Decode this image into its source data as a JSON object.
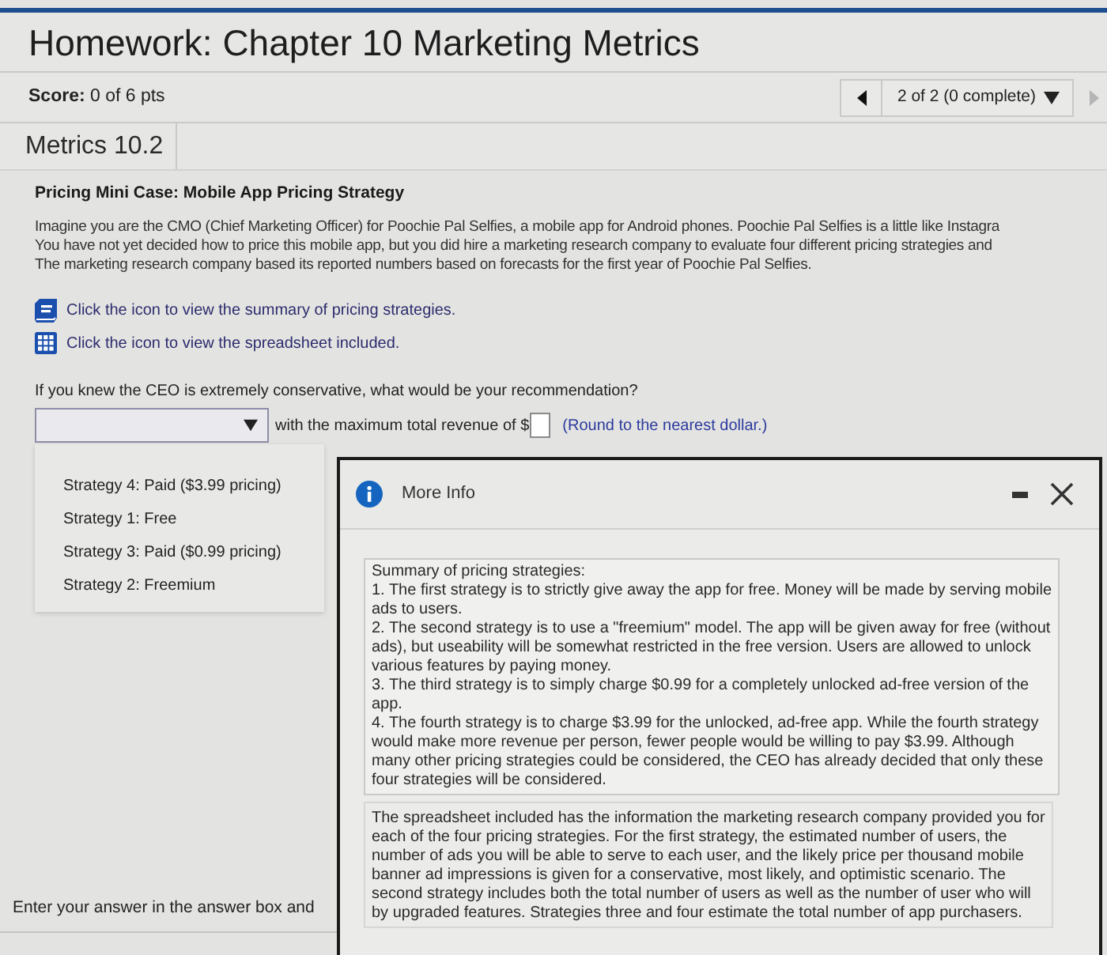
{
  "header": {
    "title": "Homework: Chapter 10 Marketing Metrics",
    "score": "**Score:** 0 of 6 pts",
    "navigator": {
      "label": "2 of 2 (0 complete)",
      "previous_disabled": false,
      "next_disabled": true
    }
  },
  "section": {
    "title": "Metrics 10.2"
  },
  "case": {
    "title": "Pricing Mini Case: Mobile App Pricing Strategy",
    "intro_lines": [
      "Imagine you are the CMO (Chief Marketing Officer) for Poochie Pal Selfies, a mobile app for Android phones. Poochie Pal Selfies is a little like Instagra",
      "You have not yet decided how to price this mobile app, but you did hire a marketing research company to evaluate four different pricing strategies and",
      "The marketing research company based its reported numbers based on forecasts for the first year of Poochie Pal Selfies."
    ],
    "links": [
      {
        "kind": "book",
        "text": "Click the icon to view the summary of pricing strategies."
      },
      {
        "kind": "table",
        "text": "Click the icon to view the spreadsheet included."
      }
    ]
  },
  "question": {
    "text": "If you knew the CEO is extremely conservative, what would be your recommendation?",
    "dropdown": {
      "expanded": true,
      "options": [
        {
          "label": "Strategy 4: Paid ($3.99 pricing)",
          "selected": false
        },
        {
          "label": "Strategy 1: Free",
          "selected": false
        },
        {
          "label": "Strategy 3: Paid ($0.99 pricing)",
          "selected": false
        },
        {
          "label": "Strategy 2: Freemium",
          "selected": false
        }
      ]
    },
    "revenue_label": "with the maximum total revenue of $",
    "hint": "(Round to the nearest dollar.)"
  },
  "instruction": "Enter your answer in the answer box and",
  "dialog": {
    "title": "More Info",
    "summary_title": "Summary of pricing strategies:",
    "summary_items": [
      "1. The first strategy is to strictly give away the app for free. Money will be made by serving mobile ads to users.",
      "2. The second strategy is to use a \"freemium\" model. The app will be given away for free (without ads), but useability will be somewhat restricted in the free version. Users are allowed to unlock various features by paying money.",
      "3. The third strategy is to simply charge $0.99 for a completely unlocked ad-free version of the app.",
      "4. The fourth strategy is to charge $3.99 for the unlocked, ad-free app. While the fourth strategy would make more revenue per person, fewer people would be willing to pay $3.99. Although many other pricing strategies could be considered, the CEO has already decided that only these four strategies will be considered."
    ],
    "spreadsheet_text": "The spreadsheet included has the information the marketing research company provided you for each of the four pricing strategies. For the first strategy, the estimated number of users, the number of ads you will be able to serve to each user, and the likely price per thousand mobile banner ad impressions is given for a conservative, most likely, and optimistic scenario. The second strategy includes both the total number of users as well as the number of user who will by upgraded features. Strategies three and four estimate the total number of app purchasers."
  }
}
